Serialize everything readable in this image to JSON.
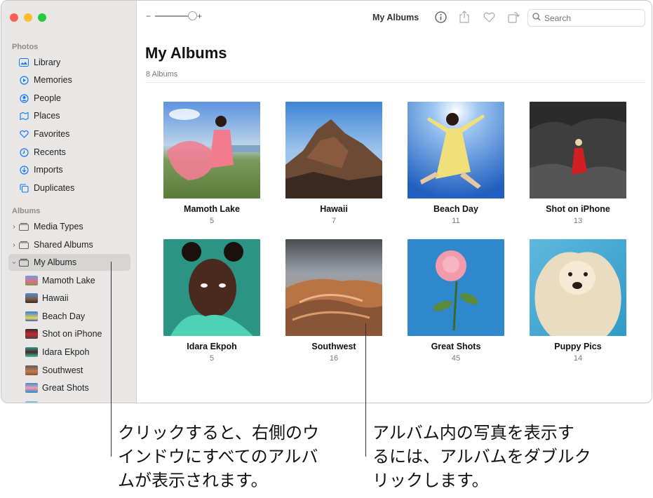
{
  "sidebar": {
    "photos_heading": "Photos",
    "items": [
      {
        "label": "Library",
        "icon": "library-icon"
      },
      {
        "label": "Memories",
        "icon": "memories-icon"
      },
      {
        "label": "People",
        "icon": "people-icon"
      },
      {
        "label": "Places",
        "icon": "places-icon"
      },
      {
        "label": "Favorites",
        "icon": "heart-icon"
      },
      {
        "label": "Recents",
        "icon": "clock-icon"
      },
      {
        "label": "Imports",
        "icon": "imports-icon"
      },
      {
        "label": "Duplicates",
        "icon": "duplicates-icon"
      }
    ],
    "albums_heading": "Albums",
    "album_groups": [
      {
        "label": "Media Types"
      },
      {
        "label": "Shared Albums"
      },
      {
        "label": "My Albums"
      }
    ],
    "my_albums": [
      {
        "label": "Mamoth Lake"
      },
      {
        "label": "Hawaii"
      },
      {
        "label": "Beach Day"
      },
      {
        "label": "Shot on iPhone"
      },
      {
        "label": "Idara Ekpoh"
      },
      {
        "label": "Southwest"
      },
      {
        "label": "Great Shots"
      }
    ]
  },
  "toolbar": {
    "zoom_minus": "−",
    "zoom_plus": "+",
    "zoom_level": 1.0,
    "title": "My Albums",
    "search_placeholder": "Search"
  },
  "main": {
    "title": "My Albums",
    "album_count": "8 Albums",
    "albums": [
      {
        "name": "Mamoth Lake",
        "count": "5"
      },
      {
        "name": "Hawaii",
        "count": "7"
      },
      {
        "name": "Beach Day",
        "count": "11"
      },
      {
        "name": "Shot on iPhone",
        "count": "13"
      },
      {
        "name": "Idara Ekpoh",
        "count": "5"
      },
      {
        "name": "Southwest",
        "count": "16"
      },
      {
        "name": "Great Shots",
        "count": "45"
      },
      {
        "name": "Puppy Pics",
        "count": "14"
      }
    ]
  },
  "callouts": {
    "left": [
      "クリックすると、右側のウ",
      "インドウにすべてのアルバ",
      "ムが表示されます。"
    ],
    "right": [
      "アルバム内の写真を表示す",
      "るには、アルバムをダブルク",
      "リックします。"
    ]
  },
  "colors": {
    "accent": "#0a7aff",
    "sidebar_bg": "#e8e7e6",
    "selected_bg": "#d6d5d4"
  }
}
